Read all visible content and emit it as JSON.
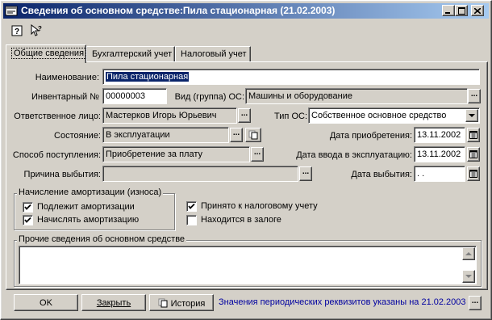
{
  "window": {
    "title": "Сведения об основном средстве:Пила стационарная (21.02.2003)"
  },
  "tabs": [
    {
      "label": "Общие сведения"
    },
    {
      "label": "Бухгалтерский учет"
    },
    {
      "label": "Налоговый учет"
    }
  ],
  "form": {
    "name_label": "Наименование:",
    "name_value": "Пила стационарная",
    "inv_label": "Инвентарный №",
    "inv_value": "00000003",
    "kind_label": "Вид (группа) ОС:",
    "kind_value": "Машины и оборудование",
    "resp_label": "Ответственное лицо:",
    "resp_value": "Мастерков Игорь Юрьевич",
    "type_label": "Тип ОС:",
    "type_value": "Собственное основное средство",
    "state_label": "Состояние:",
    "state_value": "В эксплуатации",
    "acq_date_label": "Дата приобретения:",
    "acq_date_value": "13.11.2002",
    "method_label": "Способ поступления:",
    "method_value": "Приобретение за плату",
    "commission_date_label": "Дата ввода в эксплуатацию:",
    "commission_date_value": "13.11.2002",
    "disposal_reason_label": "Причина выбытия:",
    "disposal_reason_value": "",
    "disposal_date_label": "Дата выбытия:",
    "disposal_date_value": " .  ."
  },
  "amortization": {
    "title": "Начисление амортизации (износа)",
    "subject_label": "Подлежит амортизации",
    "subject_checked": true,
    "charge_label": "Начислять амортизацию",
    "charge_checked": true
  },
  "tax": {
    "accepted_label": "Принято к налоговому учету",
    "accepted_checked": true,
    "pledged_label": "Находится в залоге",
    "pledged_checked": false
  },
  "other": {
    "title": "Прочие сведения об основном средстве",
    "value": ""
  },
  "buttons": {
    "ok": "OK",
    "close": "Закрыть",
    "history": "История"
  },
  "status": {
    "periodic_note": "Значения периодических реквизитов указаны на 21.02.2003"
  },
  "colors": {
    "title_start": "#0a246a",
    "title_end": "#a6caf0",
    "face": "#d4d0c8",
    "status_text": "#0000a0"
  }
}
